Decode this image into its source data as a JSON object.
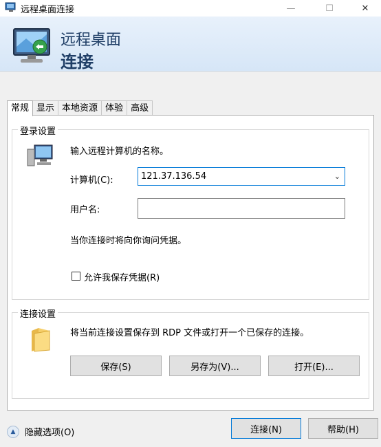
{
  "window": {
    "title": "远程桌面连接",
    "minimize_glyph": "—",
    "maximize_glyph": "☐",
    "close_glyph": "✕"
  },
  "banner": {
    "line1": "远程桌面",
    "line2": "连接"
  },
  "tabs": [
    {
      "label": "常规",
      "active": true
    },
    {
      "label": "显示",
      "active": false
    },
    {
      "label": "本地资源",
      "active": false
    },
    {
      "label": "体验",
      "active": false
    },
    {
      "label": "高级",
      "active": false
    }
  ],
  "logon": {
    "group_title": "登录设置",
    "instruction": "输入远程计算机的名称。",
    "computer_label": "计算机(C):",
    "computer_value": "121.37.136.54",
    "username_label": "用户名:",
    "username_value": "",
    "credential_note": "当你连接时将向你询问凭据。",
    "save_credentials_label": "允许我保存凭据(R)",
    "save_credentials_checked": false
  },
  "connection": {
    "group_title": "连接设置",
    "description": "将当前连接设置保存到 RDP 文件或打开一个已保存的连接。",
    "save_label": "保存(S)",
    "save_as_label": "另存为(V)...",
    "open_label": "打开(E)..."
  },
  "footer": {
    "hide_options_label": "隐藏选项(O)",
    "connect_label": "连接(N)",
    "help_label": "帮助(H)"
  },
  "icons": {
    "app": "remote-desktop-icon",
    "banner": "monitor-connection-icon",
    "computer": "computer-icon",
    "folder": "folder-icon",
    "toggle": "chevron-up-icon"
  }
}
